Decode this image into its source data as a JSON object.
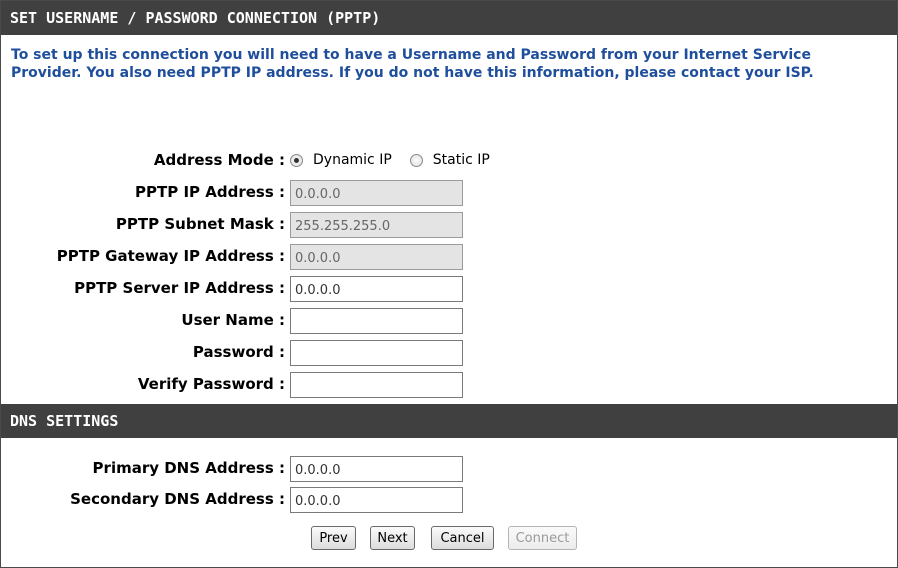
{
  "pptp_section": {
    "title": "SET USERNAME / PASSWORD CONNECTION (PPTP)",
    "intro": "To set up this connection you will need to have a Username and Password from your Internet Service Provider. You also need PPTP IP address. If you do not have this information, please contact your ISP.",
    "address_mode": {
      "label": "Address Mode :",
      "options": [
        {
          "label": "Dynamic IP",
          "selected": true
        },
        {
          "label": "Static IP",
          "selected": false
        }
      ]
    },
    "fields": {
      "pptp_ip": {
        "label": "PPTP IP Address :",
        "value": "0.0.0.0",
        "disabled": true
      },
      "subnet_mask": {
        "label": "PPTP Subnet Mask :",
        "value": "255.255.255.0",
        "disabled": true
      },
      "gateway_ip": {
        "label": "PPTP Gateway IP Address :",
        "value": "0.0.0.0",
        "disabled": true
      },
      "server_ip": {
        "label": "PPTP Server IP Address :",
        "value": "0.0.0.0",
        "disabled": false
      },
      "user_name": {
        "label": "User Name :",
        "value": "",
        "disabled": false
      },
      "password": {
        "label": "Password :",
        "value": "",
        "disabled": false
      },
      "verify_password": {
        "label": "Verify Password :",
        "value": "",
        "disabled": false
      }
    }
  },
  "dns_section": {
    "title": "DNS SETTINGS",
    "fields": {
      "primary_dns": {
        "label": "Primary DNS Address :",
        "value": "0.0.0.0"
      },
      "secondary_dns": {
        "label": "Secondary DNS Address :",
        "value": "0.0.0.0"
      }
    }
  },
  "buttons": {
    "prev": "Prev",
    "next": "Next",
    "cancel": "Cancel",
    "connect": "Connect"
  },
  "colors": {
    "header_bg": "#404040",
    "intro_text": "#1f4f9c",
    "disabled_field_bg": "#e4e4e4"
  }
}
